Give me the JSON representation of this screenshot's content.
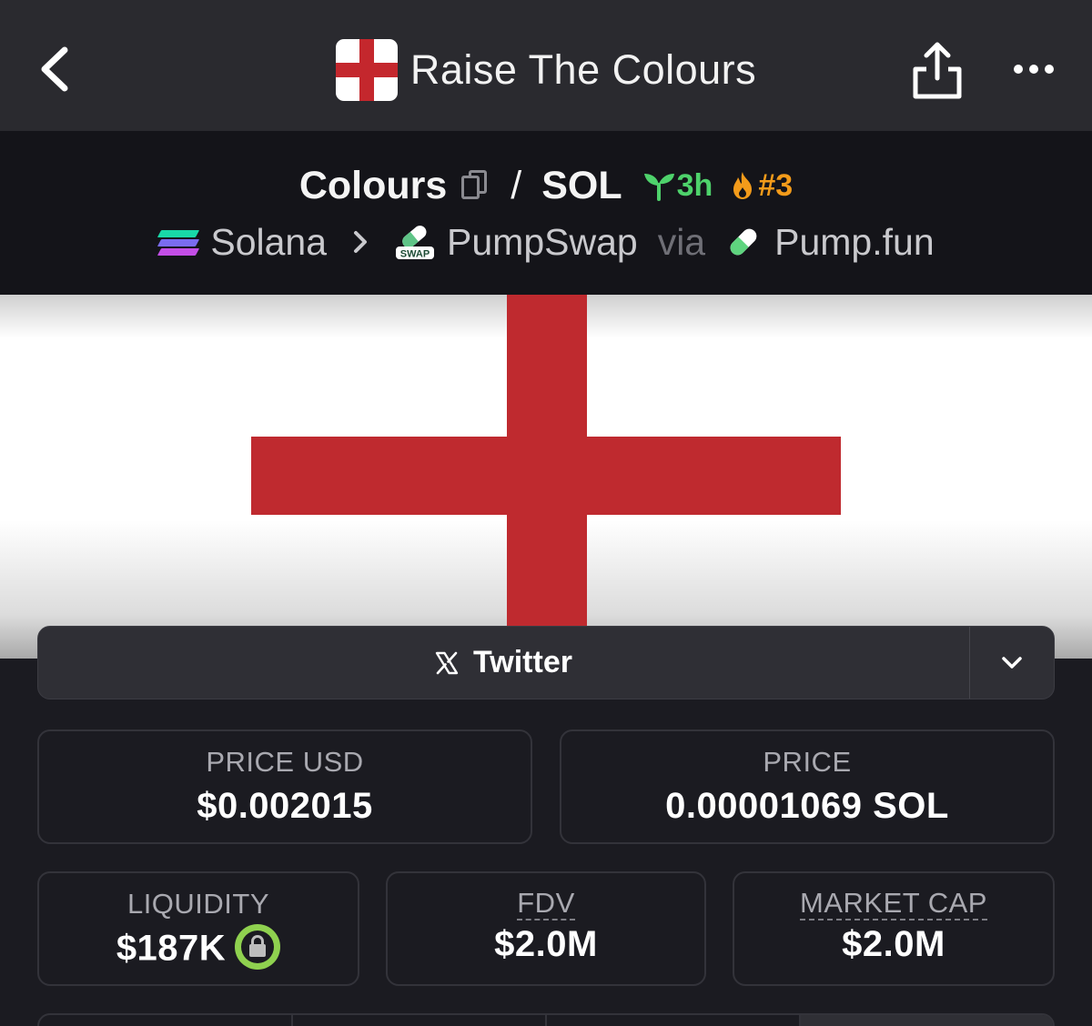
{
  "header": {
    "title": "Raise The Colours",
    "back_icon": "chevron-left-icon",
    "share_icon": "share-icon",
    "more_icon": "more-horizontal-icon"
  },
  "pair": {
    "base": "Colours",
    "separator": "/",
    "quote": "SOL",
    "age": "3h",
    "trending_rank": "#3",
    "colors": {
      "age": "#4ed26b",
      "rank": "#f39b1a"
    }
  },
  "path": {
    "chain": "Solana",
    "dex": "PumpSwap",
    "via": "via",
    "launchpad": "Pump.fun",
    "dex_icon_text": "SWAP"
  },
  "social": {
    "label": "Twitter"
  },
  "stats": {
    "price_usd": {
      "label": "PRICE USD",
      "value": "$0.002015"
    },
    "price": {
      "label": "PRICE",
      "value": "0.00001069 SOL"
    },
    "liquidity": {
      "label": "LIQUIDITY",
      "value": "$187K"
    },
    "fdv": {
      "label": "FDV",
      "value": "$2.0M"
    },
    "market_cap": {
      "label": "MARKET CAP",
      "value": "$2.0M"
    }
  },
  "theme": {
    "flag_red": "#bf2a2f",
    "background": "#1b1b21",
    "topbar": "#2a2a2f",
    "lock_green": "#8fd14f"
  }
}
